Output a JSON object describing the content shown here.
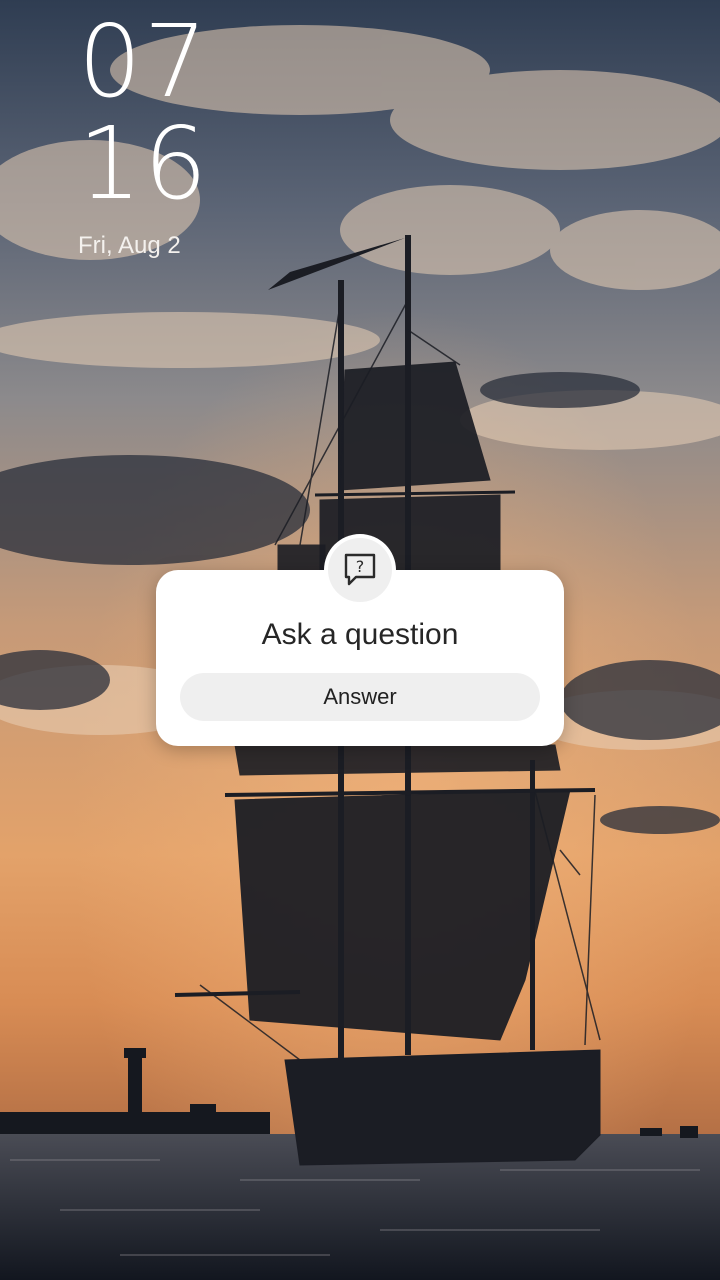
{
  "lockscreen": {
    "clock_hours": "07",
    "clock_minutes": "16",
    "date": "Fri, Aug 2"
  },
  "question_sticker": {
    "icon": "question-bubble-icon",
    "title": "Ask a question",
    "answer_label": "Answer"
  },
  "wallpaper": {
    "subject": "tall-ship-silhouette-at-sunset",
    "colors": {
      "sky_top": "#3a4a5e",
      "sky_mid": "#9a8677",
      "sky_glow": "#e8a36a",
      "horizon": "#d98a50",
      "water": "#1c2330",
      "silhouette": "#1a1c22"
    }
  }
}
